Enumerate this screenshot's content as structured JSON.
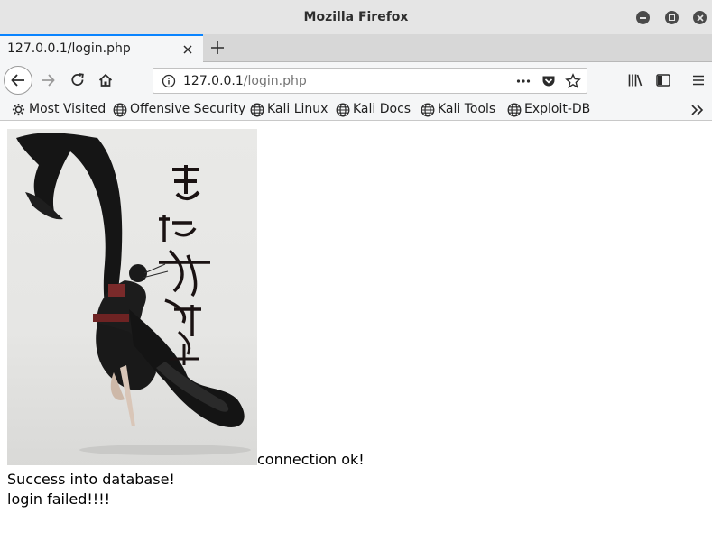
{
  "window": {
    "title": "Mozilla Firefox"
  },
  "tabs": [
    {
      "label": "127.0.0.1/login.php",
      "active": true
    }
  ],
  "address_bar": {
    "host": "127.0.0.1",
    "path": "/login.php"
  },
  "bookmarks": [
    {
      "label": "Most Visited",
      "icon": "gear-icon"
    },
    {
      "label": "Offensive Security",
      "icon": "globe-icon"
    },
    {
      "label": "Kali Linux",
      "icon": "globe-icon"
    },
    {
      "label": "Kali Docs",
      "icon": "globe-icon"
    },
    {
      "label": "Kali Tools",
      "icon": "globe-icon"
    },
    {
      "label": "Exploit-DB",
      "icon": "globe-icon"
    }
  ],
  "page": {
    "image": {
      "description_icon": "dancer-poster-image"
    },
    "messages": [
      "connection ok!",
      "Success into database!",
      "login failed!!!!"
    ]
  },
  "colors": {
    "tab_accent": "#0a84ff",
    "titlebar": "#e5e5e5",
    "toolbar": "#f5f6f7"
  }
}
